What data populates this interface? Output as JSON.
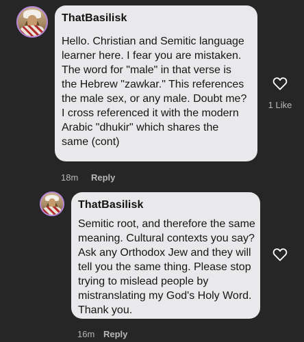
{
  "comments": [
    {
      "username": "ThatBasilisk",
      "text": "Hello. Christian and Semitic language\nlearner here. I fear you are mistaken.\nThe word for \"male\" in that verse is\nthe Hebrew \"zawkar.\" This references\nthe male sex, or any male. Doubt me?\nI cross referenced it with the modern\nArabic \"dhukir\" which shares the\nsame (cont)",
      "time": "18m",
      "reply_label": "Reply",
      "like_count": "1 Like",
      "like_icon": "heart-outline-icon"
    },
    {
      "username": "ThatBasilisk",
      "text": "Semitic root, and therefore the same\nmeaning. Cultural contexts you say?\nAsk any Orthodox Jew and they will\ntell you the same thing. Please stop\ntrying to mislead people by\nmistranslating my God's Holy Word.\nThank you.",
      "time": "16m",
      "reply_label": "Reply",
      "like_icon": "heart-outline-icon"
    }
  ],
  "colors": {
    "background": "#262626",
    "bubble": "#e9e9eb",
    "avatar_ring": "#b886d8",
    "meta_text": "#b8b8b8"
  }
}
